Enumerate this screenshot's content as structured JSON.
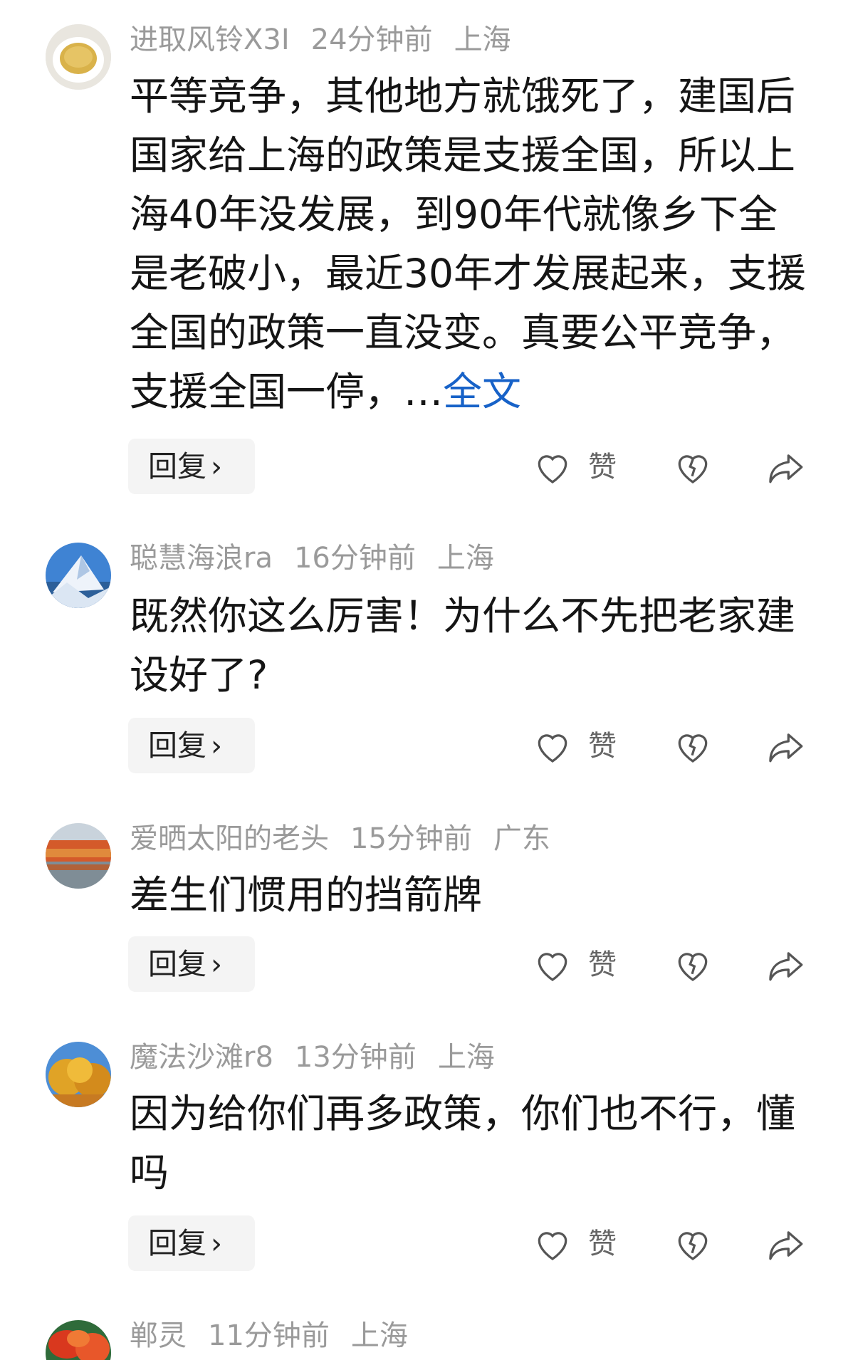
{
  "comments": [
    {
      "user": "进取风铃X3I",
      "time": "24分钟前",
      "location": "上海",
      "text": "平等竞争，其他地方就饿死了，建国后国家给上海的政策是支援全国，所以上海40年没发展，到90年代就像乡下全是老破小，最近30年才发展起来，支援全国的政策一直没变。真要公平竞争，支援全国一停，…",
      "more_link": "全文",
      "reply_label": "回复",
      "like_label": "赞",
      "avatar_icon": "tea-cup-avatar"
    },
    {
      "user": "聪慧海浪ra",
      "time": "16分钟前",
      "location": "上海",
      "text": "既然你这么厉害！为什么不先把老家建设好了?",
      "reply_label": "回复",
      "like_label": "赞",
      "avatar_icon": "snow-mountain-avatar"
    },
    {
      "user": "爱晒太阳的老头",
      "time": "15分钟前",
      "location": "广东",
      "text": "差生们惯用的挡箭牌",
      "reply_label": "回复",
      "like_label": "赞",
      "avatar_icon": "autumn-lake-avatar"
    },
    {
      "user": "魔法沙滩r8",
      "time": "13分钟前",
      "location": "上海",
      "text": "因为给你们再多政策，你们也不行，懂吗",
      "reply_label": "回复",
      "like_label": "赞",
      "avatar_icon": "golden-trees-avatar"
    },
    {
      "user": "郸灵",
      "time": "11分钟前",
      "location": "上海",
      "avatar_icon": "red-leaves-avatar"
    }
  ],
  "colors": {
    "meta_text": "#9a9a9a",
    "body_text": "#151515",
    "link": "#1762c8",
    "reply_bg": "#f4f4f4",
    "icon": "#555555"
  },
  "icons": [
    "heart-outline-icon",
    "broken-heart-icon",
    "share-arrow-icon",
    "chevron-right-icon"
  ]
}
